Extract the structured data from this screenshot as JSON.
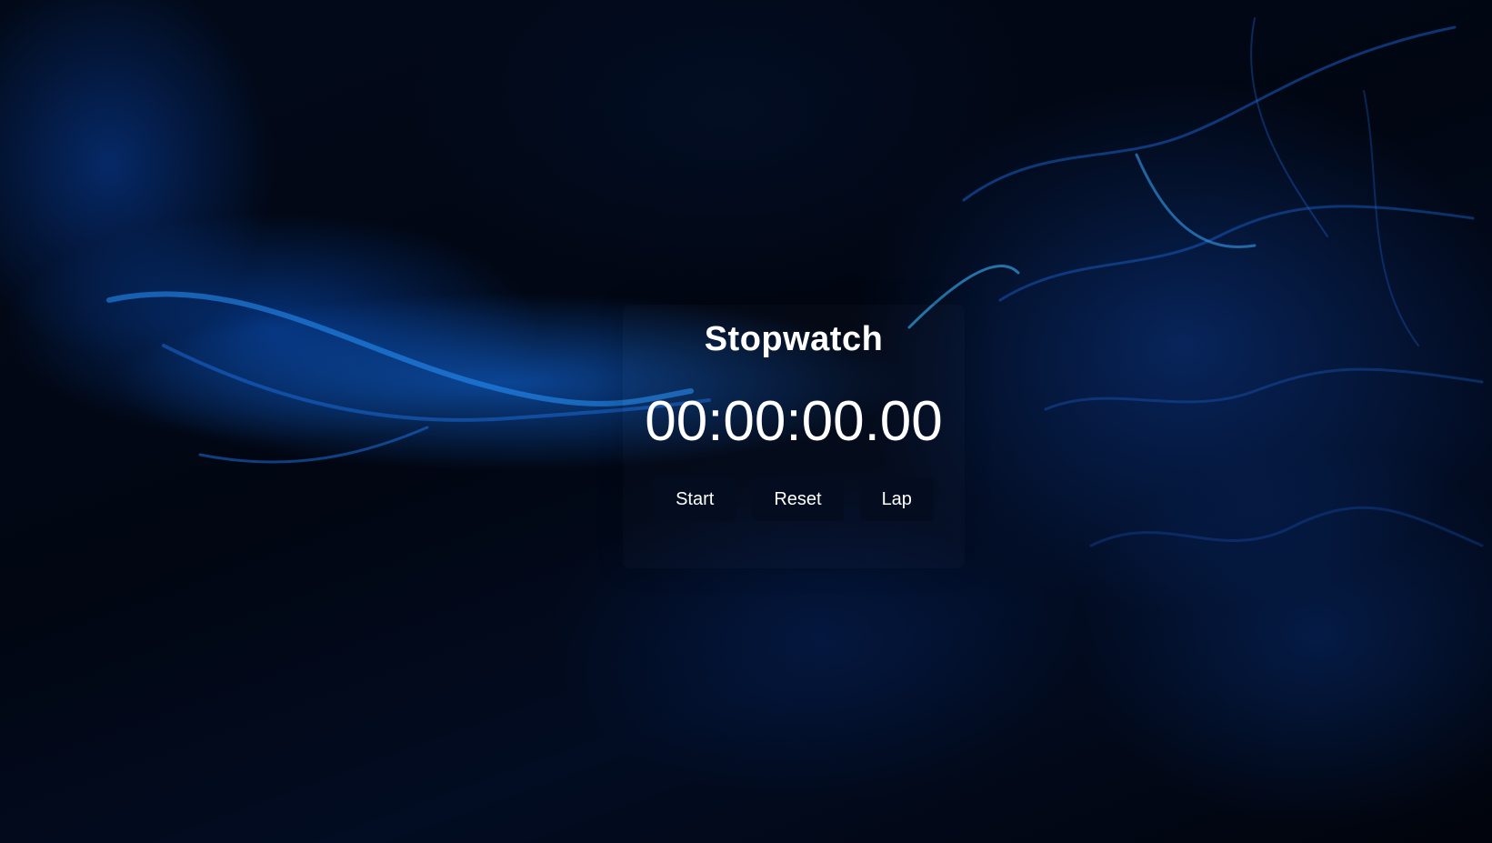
{
  "stopwatch": {
    "title": "Stopwatch",
    "time": "00:00:00.00",
    "buttons": {
      "start": "Start",
      "reset": "Reset",
      "lap": "Lap"
    }
  },
  "colors": {
    "background": "#01050f",
    "glow": "#1478ff",
    "button_bg": "#040c20",
    "text": "#ffffff"
  }
}
